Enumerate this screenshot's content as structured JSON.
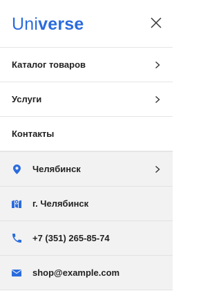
{
  "logo": {
    "part1": "Uni",
    "part2": "verse"
  },
  "menu": [
    {
      "label": "Каталог товаров",
      "has_arrow": true
    },
    {
      "label": "Услуги",
      "has_arrow": true
    },
    {
      "label": "Контакты",
      "has_arrow": false
    }
  ],
  "info": [
    {
      "icon": "location-pin-icon",
      "label": "Челябинск",
      "has_arrow": true
    },
    {
      "icon": "map-icon",
      "label": "г. Челябинск",
      "has_arrow": false
    },
    {
      "icon": "phone-icon",
      "label": "+7 (351) 265-85-74",
      "has_arrow": false
    },
    {
      "icon": "envelope-icon",
      "label": "shop@example.com",
      "has_arrow": false
    }
  ],
  "colors": {
    "accent": "#2a6cde",
    "text": "#222222",
    "info_bg": "#f2f2f2"
  }
}
